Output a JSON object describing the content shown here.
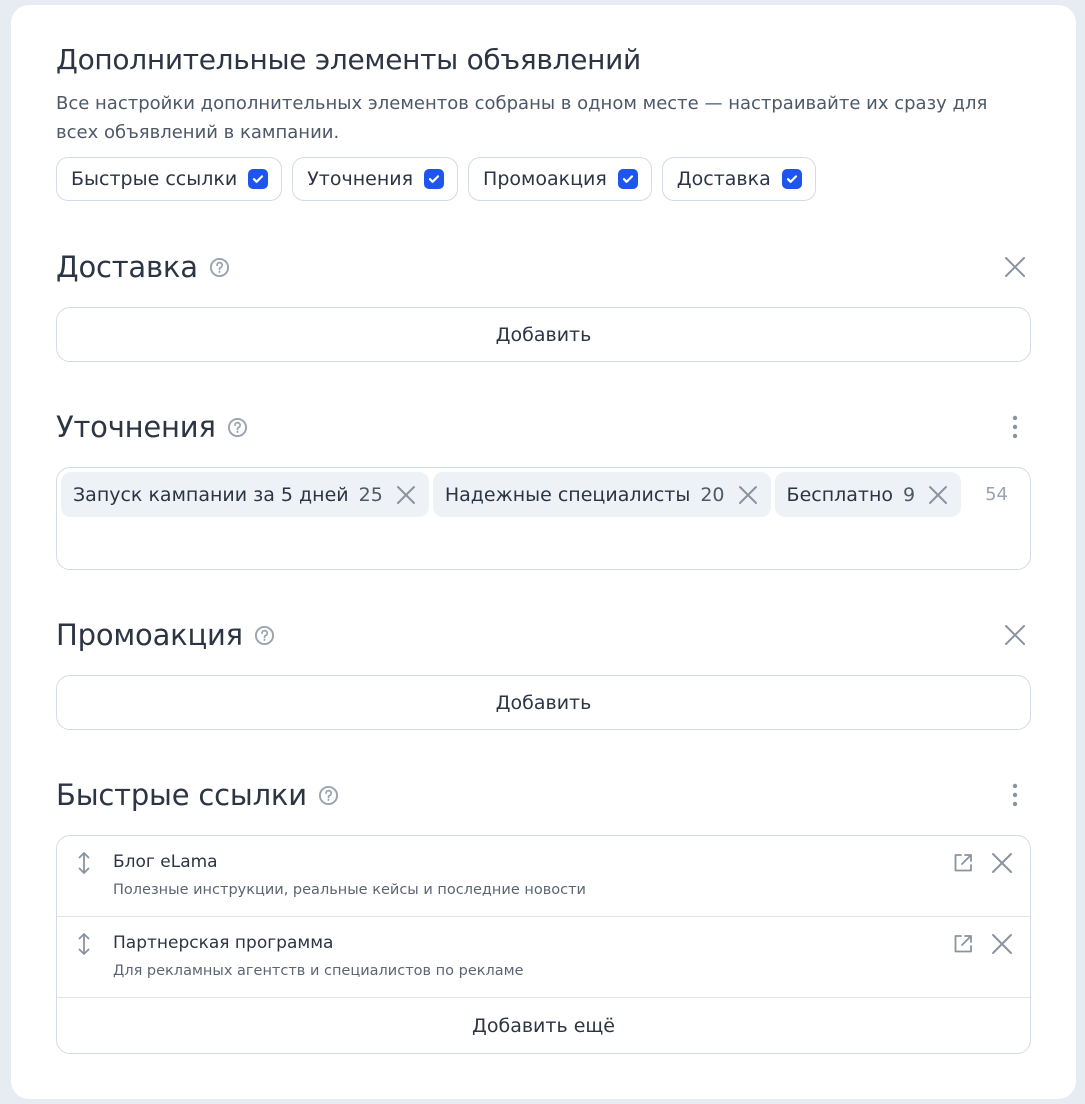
{
  "header": {
    "title": "Дополнительные элементы объявлений",
    "description": "Все настройки дополнительных элементов собраны в одном месте — настраивайте их сразу для всех объявлений в кампании."
  },
  "filters": [
    {
      "label": "Быстрые ссылки",
      "checked": true
    },
    {
      "label": "Уточнения",
      "checked": true
    },
    {
      "label": "Промоакция",
      "checked": true
    },
    {
      "label": "Доставка",
      "checked": true
    }
  ],
  "delivery": {
    "title": "Доставка",
    "add_label": "Добавить"
  },
  "callouts": {
    "title": "Уточнения",
    "tags": [
      {
        "text": "Запуск кампании за 5 дней",
        "count": "25"
      },
      {
        "text": "Надежные специалисты",
        "count": "20"
      },
      {
        "text": "Бесплатно",
        "count": "9"
      }
    ],
    "total": "54"
  },
  "promo": {
    "title": "Промоакция",
    "add_label": "Добавить"
  },
  "sitelinks": {
    "title": "Быстрые ссылки",
    "items": [
      {
        "title": "Блог eLama",
        "description": "Полезные инструкции, реальные кейсы и последние новости"
      },
      {
        "title": "Партнерская программа",
        "description": "Для рекламных агентств и специалистов по рекламе"
      }
    ],
    "add_more_label": "Добавить ещё"
  },
  "colors": {
    "accent": "#1e55ec",
    "text": "#2c3544",
    "muted": "#9aa3b0",
    "border": "#d5dbe3",
    "tag_bg": "#eef1f5",
    "page_bg": "#e7ecf2"
  }
}
